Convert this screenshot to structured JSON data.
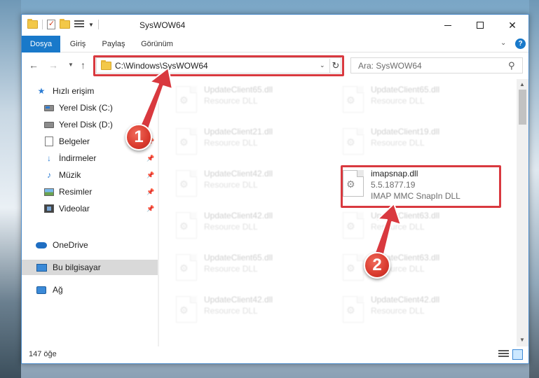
{
  "window": {
    "title": "SysWOW64",
    "controls": {
      "minimize": "—",
      "maximize": "☐",
      "close": "✕"
    }
  },
  "ribbon": {
    "tabs": [
      {
        "label": "Dosya"
      },
      {
        "label": "Giriş"
      },
      {
        "label": "Paylaş"
      },
      {
        "label": "Görünüm"
      }
    ],
    "help": "?"
  },
  "address": {
    "path": "C:\\Windows\\SysWOW64",
    "search_placeholder": "Ara: SysWOW64"
  },
  "sidebar": {
    "items": [
      {
        "label": "Hızlı erişim",
        "icon": "star-icon"
      },
      {
        "label": "Yerel Disk (C:)",
        "icon": "drive-icon"
      },
      {
        "label": "Yerel Disk (D:)",
        "icon": "drive-icon"
      },
      {
        "label": "Belgeler",
        "icon": "documents-icon"
      },
      {
        "label": "İndirmeler",
        "icon": "download-icon"
      },
      {
        "label": "Müzik",
        "icon": "music-icon"
      },
      {
        "label": "Resimler",
        "icon": "pictures-icon"
      },
      {
        "label": "Videolar",
        "icon": "videos-icon"
      },
      {
        "label": "OneDrive",
        "icon": "cloud-icon"
      },
      {
        "label": "Bu bilgisayar",
        "icon": "computer-icon"
      },
      {
        "label": "Ağ",
        "icon": "network-icon"
      }
    ]
  },
  "files": {
    "left": [
      {
        "name": "UpdateClient65.dll",
        "desc": "Resource DLL"
      },
      {
        "name": "UpdateClient21.dll",
        "desc": "Resource DLL"
      },
      {
        "name": "UpdateClient42.dll",
        "desc": "Resource DLL"
      },
      {
        "name": "UpdateClient42.dll",
        "desc": "Resource DLL"
      },
      {
        "name": "UpdateClient65.dll",
        "desc": "Resource DLL"
      },
      {
        "name": "UpdateClient42.dll",
        "desc": "Resource DLL"
      }
    ],
    "right": [
      {
        "name": "UpdateClient65.dll",
        "desc": "Resource DLL"
      },
      {
        "name": "UpdateClient19.dll",
        "desc": "Resource DLL"
      },
      {
        "name": "imapsnap.dll",
        "version": "5.5.1877.19",
        "desc": "IMAP MMC SnapIn DLL"
      },
      {
        "name": "UpdateClient63.dll",
        "desc": "Resource DLL"
      },
      {
        "name": "UpdateClient63.dll",
        "desc": "Resource DLL"
      },
      {
        "name": "UpdateClient42.dll",
        "desc": "Resource DLL"
      }
    ]
  },
  "status": {
    "item_count": "147 öğe"
  },
  "callouts": {
    "step1": "1",
    "step2": "2"
  },
  "colors": {
    "accent": "#1979ca",
    "highlight": "#d9393f",
    "selected_bg": "#d9d9d9"
  }
}
